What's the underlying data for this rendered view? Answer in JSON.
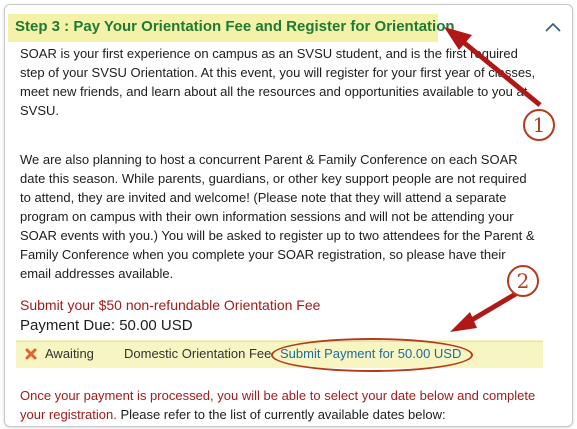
{
  "step": {
    "title": "Step 3 : Pay Your Orientation Fee and Register for Orientation"
  },
  "paragraphs": {
    "p1": "SOAR is your first experience on campus as an SVSU student, and is the first required step of your SVSU Orientation. At this event, you will register for your first year of classes, meet new friends, and learn about all the resources and opportunities available to you at SVSU.",
    "p2": "We are also planning to host a concurrent Parent & Family Conference on each SOAR date this season. While parents, guardians, or other key support people are not required to attend, they are invited and welcome! (Please note that they will attend a separate program on campus with their own information sessions and will not be attending your SOAR events with you.) You will be asked to register up to two attendees for the Parent & Family Conference when you complete your SOAR registration, so please have their email addresses available."
  },
  "fee": {
    "title": "Submit your $50 non-refundable Orientation Fee",
    "payment_due": "Payment Due: 50.00 USD"
  },
  "payment_row": {
    "status": "Awaiting",
    "fee_type": "Domestic Orientation Fee",
    "link": "Submit Payment for 50.00 USD"
  },
  "after": {
    "red_text": "Once your payment is processed, you will be able to select your date below and complete your registration.",
    "black_text": " Please refer to the list of currently available dates below:"
  },
  "annotations": {
    "num1": "1",
    "num2": "2"
  },
  "colors": {
    "step_title": "#1f7a33",
    "highlight": "#f4f2a8",
    "fee_red": "#a31b1b",
    "link_blue": "#1d6aa5",
    "annotation": "#b53b1c"
  },
  "icons": {
    "collapse": "chevron-up-icon",
    "status": "x-icon"
  }
}
